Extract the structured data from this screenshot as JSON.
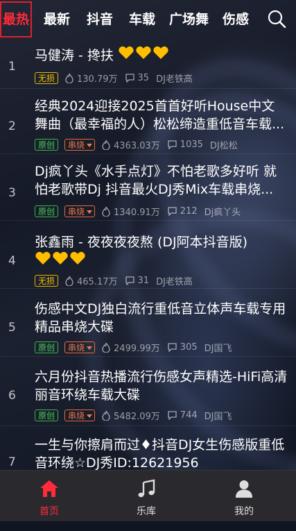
{
  "tabs": [
    {
      "label": "最热",
      "active": true
    },
    {
      "label": "最新"
    },
    {
      "label": "抖音"
    },
    {
      "label": "车载"
    },
    {
      "label": "广场舞"
    },
    {
      "label": "伤感"
    }
  ],
  "songs": [
    {
      "rank": "1",
      "title": "马健涛 - 搀扶",
      "hearts": 3,
      "tags": [
        "无损"
      ],
      "plays": "130.79万",
      "comments": "35",
      "author": "DJ老铁高"
    },
    {
      "rank": "2",
      "title": "经典2024迎接2025首首好听House中文舞曲（最幸福的人）松松缔造重低音车载...",
      "tags": [
        "原创",
        "串烧"
      ],
      "plays": "4363.03万",
      "comments": "1035",
      "author": "DJ松松"
    },
    {
      "rank": "3",
      "title": "Dj疯丫头《水手点灯》不怕老歌多好听 就怕老歌带Dj 抖音最火DJ秀Mix车载串烧...",
      "tags": [
        "原创",
        "串烧"
      ],
      "plays": "1340.91万",
      "comments": "212",
      "author": "Dj疯丫头"
    },
    {
      "rank": "4",
      "title": "张鑫雨 - 夜夜夜夜熬 (DJ阿本抖音版)",
      "hearts": 3,
      "tags": [
        "无损"
      ],
      "plays": "465.17万",
      "comments": "31",
      "author": "DJ老铁高"
    },
    {
      "rank": "5",
      "title": "伤感中文DJ独白流行重低音立体声车载专用精品串烧大碟",
      "tags": [
        "原创",
        "串烧"
      ],
      "plays": "2499.99万",
      "comments": "305",
      "author": "DJ国飞"
    },
    {
      "rank": "6",
      "title": "六月份抖音热播流行伤感女声精选-HiFi高清丽音环绕车载大碟",
      "tags": [
        "原创",
        "串烧"
      ],
      "plays": "5482.09万",
      "comments": "744",
      "author": "DJ国飞"
    },
    {
      "rank": "7",
      "title": "一生与你擦肩而过♦抖音DJ女生伤感版重低音环绕☆DJ秀ID:12621956"
    }
  ],
  "bottom_nav": [
    {
      "label": "首页",
      "icon": "home-icon",
      "active": true
    },
    {
      "label": "乐库",
      "icon": "music-note-icon"
    },
    {
      "label": "我的",
      "icon": "person-icon"
    }
  ],
  "colors": {
    "accent": "#ff2a3a",
    "lossless": "#f3c300",
    "original": "#4ccf58",
    "mix": "#f07a48",
    "heart": "#ffbf00"
  }
}
